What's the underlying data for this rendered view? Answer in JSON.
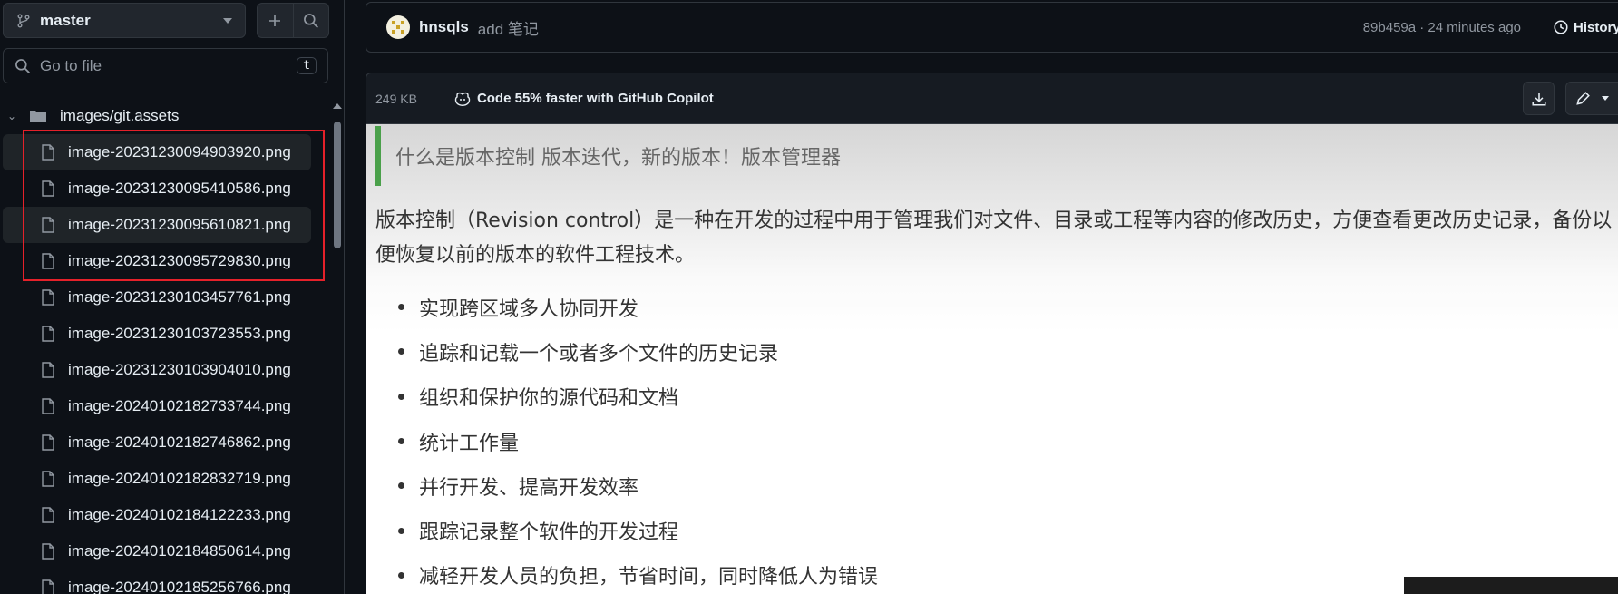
{
  "branch": {
    "name": "master"
  },
  "file_search": {
    "placeholder": "Go to file",
    "shortcut": "t"
  },
  "tree": {
    "folder": "images/git.assets",
    "files": [
      "image-20231230094903920.png",
      "image-20231230095410586.png",
      "image-20231230095610821.png",
      "image-20231230095729830.png",
      "image-20231230103457761.png",
      "image-20231230103723553.png",
      "image-20231230103904010.png",
      "image-20240102182733744.png",
      "image-20240102182746862.png",
      "image-20240102182832719.png",
      "image-20240102184122233.png",
      "image-20240102184850614.png",
      "image-20240102185256766.png"
    ]
  },
  "commit": {
    "author": "hnsqls",
    "message": "add 笔记",
    "meta": "89b459a · 24 minutes ago",
    "history_label": "History"
  },
  "file_header": {
    "size": "249  KB",
    "copilot_label": "Code 55% faster with GitHub Copilot"
  },
  "content": {
    "blockquote": "什么是版本控制   版本迭代，新的版本！版本管理器",
    "paragraph": "版本控制（Revision control）是一种在开发的过程中用于管理我们对文件、目录或工程等内容的修改历史，方便查看更改历史记录，备份以便恢复以前的版本的软件工程技术。",
    "bullets": [
      "实现跨区域多人协同开发",
      "追踪和记载一个或者多个文件的历史记录",
      "组织和保护你的源代码和文档",
      "统计工作量",
      "并行开发、提高开发效率",
      "跟踪记录整个软件的开发过程",
      "减轻开发人员的负担，节省时间，同时降低人为错误"
    ]
  },
  "colors": {
    "background": "#0d1117",
    "border": "#30363d",
    "selection_highlight": "#e5212a",
    "blockquote_bar": "#4aa04a"
  }
}
